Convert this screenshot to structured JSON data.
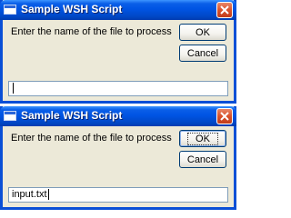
{
  "dialogs": [
    {
      "title": "Sample WSH Script",
      "prompt": "Enter the name of the file to process",
      "ok_label": "OK",
      "cancel_label": "Cancel",
      "input_value": ""
    },
    {
      "title": "Sample WSH Script",
      "prompt": "Enter the name of the file to process",
      "ok_label": "OK",
      "cancel_label": "Cancel",
      "input_value": "input.txt"
    }
  ],
  "icons": {
    "window": "app-window-icon",
    "close": "close-icon"
  },
  "colors": {
    "titlebar": "#0054e3",
    "window_border": "#0a4fd6",
    "dialog_background": "#ece9d8",
    "close_button": "#d9522b"
  }
}
